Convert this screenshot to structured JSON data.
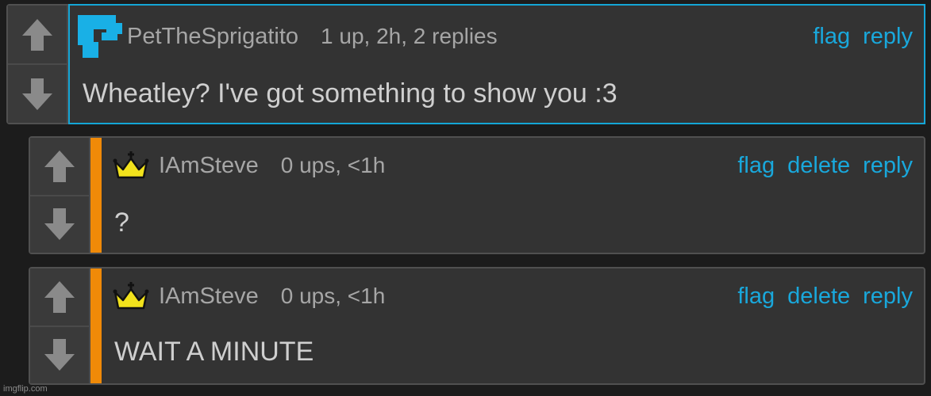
{
  "comments": [
    {
      "username": "PetTheSprigatito",
      "meta": "1 up, 2h, 2 replies",
      "actions": [
        "flag",
        "reply"
      ],
      "text": "Wheatley? I've got something to show you :3"
    },
    {
      "username": "IAmSteve",
      "meta": "0 ups, <1h",
      "actions": [
        "flag",
        "delete",
        "reply"
      ],
      "text": "?"
    },
    {
      "username": "IAmSteve",
      "meta": "0 ups, <1h",
      "actions": [
        "flag",
        "delete",
        "reply"
      ],
      "text": "WAIT A MINUTE"
    }
  ],
  "watermark": "imgflip.com",
  "icons": {
    "upvote": "arrow-up-icon",
    "downvote": "arrow-down-icon",
    "avatar": "pixel-avatar-icon",
    "badge": "crown-icon"
  },
  "colors": {
    "link": "#19a8dc",
    "op_border": "#14a6d6",
    "reply_accent": "#f08a08",
    "crown": "#f2e21c"
  }
}
